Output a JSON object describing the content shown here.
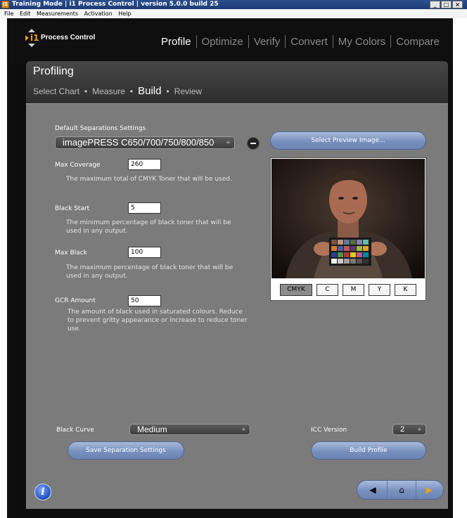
{
  "window": {
    "title": "Training Mode | i1 Process Control  | version 5.0.0 build 25",
    "app_icon_text": "i1",
    "controls": [
      "_",
      "□",
      "×"
    ]
  },
  "menu": [
    "File",
    "Edit",
    "Measurements",
    "Activation",
    "Help"
  ],
  "header": {
    "logo_mark": "i1",
    "logo_text": "Process Control",
    "tabs": [
      {
        "label": "Profile",
        "active": true
      },
      {
        "label": "Optimize",
        "active": false
      },
      {
        "label": "Verify",
        "active": false
      },
      {
        "label": "Convert",
        "active": false
      },
      {
        "label": "My Colors",
        "active": false
      },
      {
        "label": "Compare",
        "active": false
      }
    ]
  },
  "panel": {
    "title": "Profiling",
    "steps": [
      "Select Chart",
      "Measure",
      "Build",
      "Review"
    ],
    "active_step": "Build"
  },
  "separations": {
    "label": "Default Separations Settings",
    "selected": "imagePRESS C650/700/750/800/850",
    "arrow": "÷"
  },
  "settings": {
    "max_coverage": {
      "label": "Max Coverage",
      "value": "260",
      "description": "The maximum total of CMYK Toner that will be used."
    },
    "black_start": {
      "label": "Black Start",
      "value": "5",
      "description": "The minimum percentage of black toner that will be used in any output."
    },
    "max_black": {
      "label": "Max Black",
      "value": "100",
      "description": "The maximum percentage of black toner that will be used in any output."
    },
    "gcr_amount": {
      "label": "GCR Amount",
      "value": "50",
      "description": "The amount of black used in saturated colours. Reduce to prevent gritty appearance or increase to reduce toner use."
    }
  },
  "preview": {
    "button": "Select Preview Image...",
    "channels": [
      "CMYK",
      "C",
      "M",
      "Y",
      "K"
    ],
    "active_channel": "CMYK"
  },
  "black_curve": {
    "label": "Black Curve",
    "selected": "Medium",
    "arrow": "÷"
  },
  "icc_version": {
    "label": "ICC Version",
    "selected": "2",
    "arrow": "÷"
  },
  "buttons": {
    "save": "Save Separation Settings",
    "build": "Build Profile",
    "info": "i"
  },
  "nav": {
    "back": "◀",
    "home": "⌂",
    "forward": "▶"
  },
  "colors": {
    "accent": "#e8a21a",
    "panel_bg": "#7b7b7b",
    "button_blue": "#7890be",
    "title_bar": "#1c3b73"
  }
}
